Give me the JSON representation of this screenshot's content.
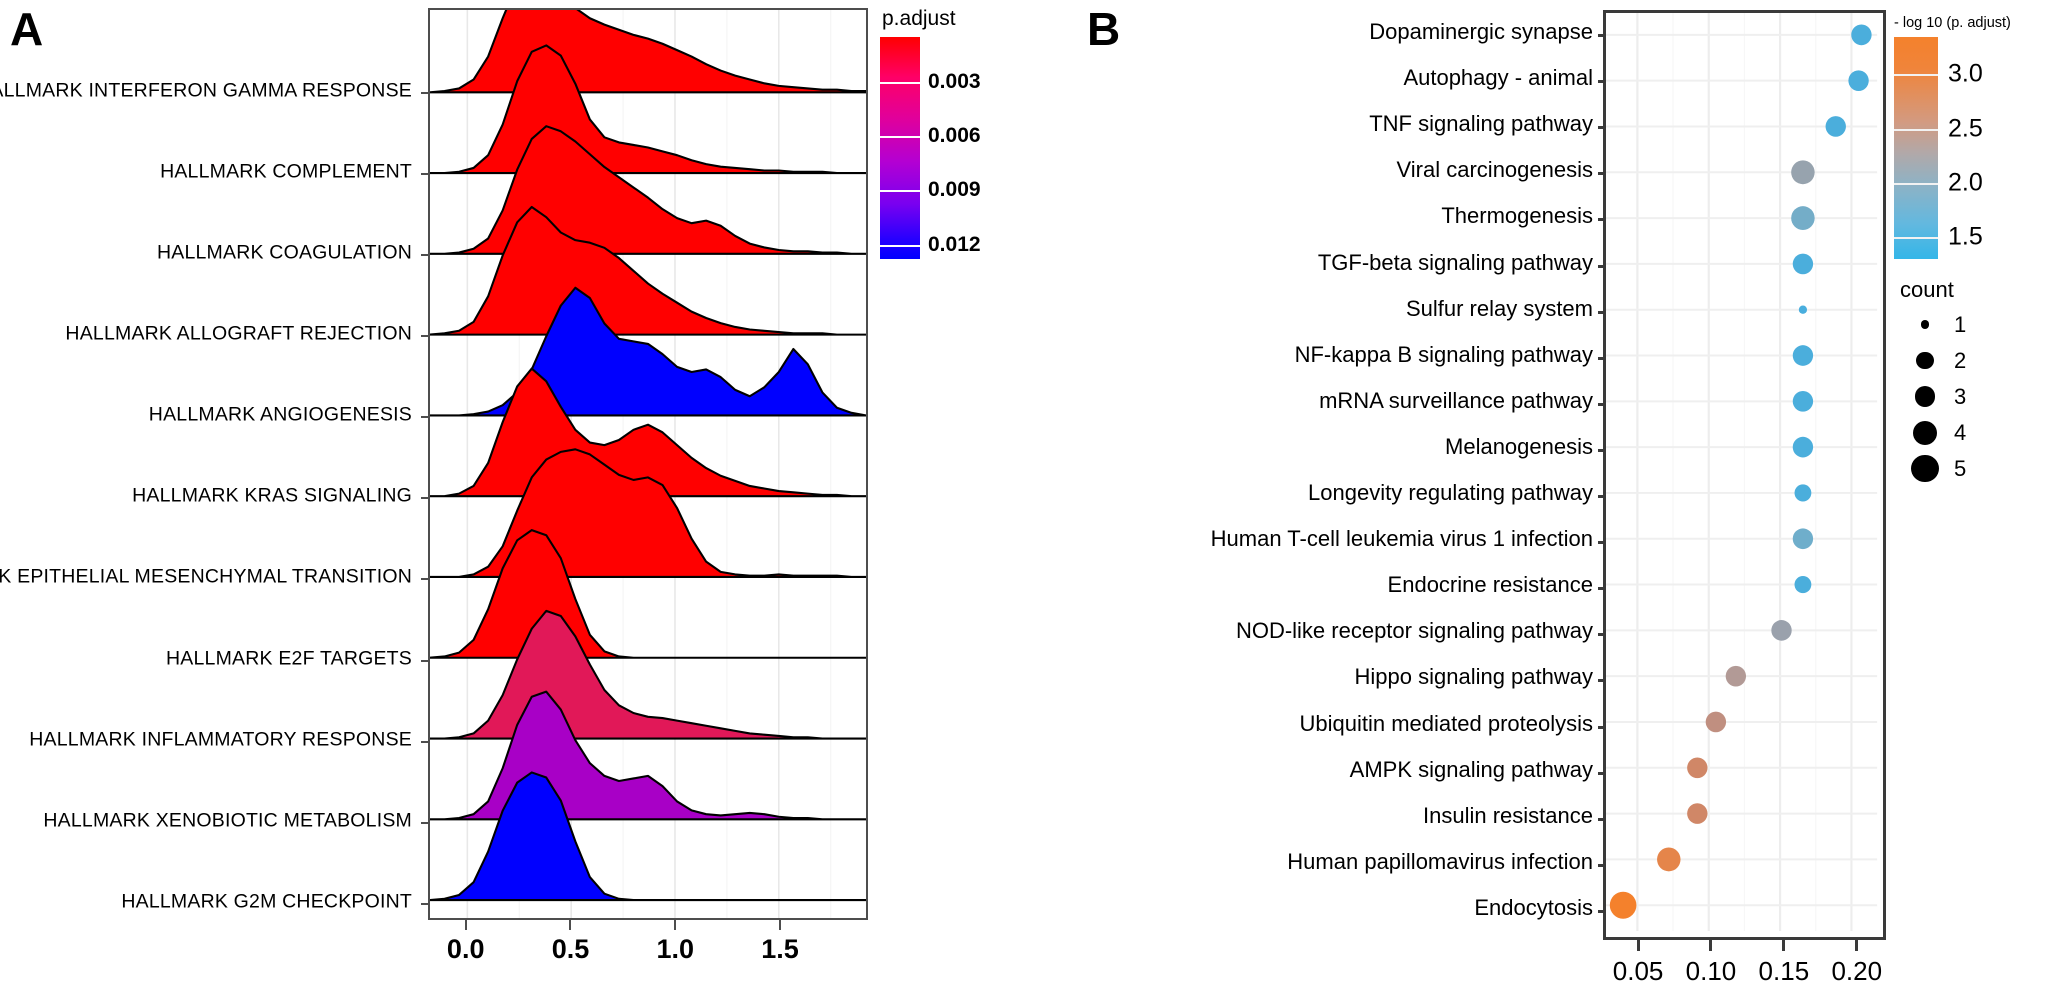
{
  "panels": {
    "a_letter": "A",
    "b_letter": "B"
  },
  "chart_data": [
    {
      "type": "area",
      "id": "ridgeline-gsea",
      "title": "",
      "xlabel": "",
      "ylabel": "",
      "xlim": [
        -0.18,
        1.92
      ],
      "xticks": [
        "0.0",
        "0.5",
        "1.0",
        "1.5"
      ],
      "xtick_values": [
        0.0,
        0.5,
        1.0,
        1.5
      ],
      "grid": true,
      "legend": {
        "title": "p.adjust",
        "ticks": [
          "0.003",
          "0.006",
          "0.009",
          "0.012"
        ],
        "tick_values": [
          0.003,
          0.006,
          0.009,
          0.012
        ],
        "colors": {
          "low": "#FF0000",
          "high": "#0000FF"
        },
        "range": [
          0.0005,
          0.0128
        ]
      },
      "categories": [
        "HALLMARK INTERFERON GAMMA RESPONSE",
        "HALLMARK COMPLEMENT",
        "HALLMARK COAGULATION",
        "HALLMARK ALLOGRAFT REJECTION",
        "HALLMARK ANGIOGENESIS",
        "HALLMARK KRAS SIGNALING",
        "HALLMARK EPITHELIAL MESENCHYMAL TRANSITION",
        "HALLMARK E2F TARGETS",
        "HALLMARK INFLAMMATORY RESPONSE",
        "HALLMARK XENOBIOTIC METABOLISM",
        "HALLMARK G2M CHECKPOINT"
      ],
      "series": [
        {
          "name": "HALLMARK INTERFERON GAMMA RESPONSE",
          "p_adjust": 0.0012,
          "color": "#FF0000",
          "density": [
            0.0,
            0.01,
            0.03,
            0.1,
            0.28,
            0.58,
            0.85,
            1.0,
            0.95,
            0.8,
            0.66,
            0.58,
            0.53,
            0.49,
            0.45,
            0.42,
            0.38,
            0.33,
            0.28,
            0.22,
            0.17,
            0.13,
            0.1,
            0.07,
            0.05,
            0.04,
            0.03,
            0.02,
            0.02,
            0.01,
            0.01
          ]
        },
        {
          "name": "HALLMARK COMPLEMENT",
          "p_adjust": 0.0013,
          "color": "#FF0000",
          "density": [
            0.0,
            0.0,
            0.01,
            0.04,
            0.14,
            0.38,
            0.72,
            0.95,
            1.0,
            0.92,
            0.7,
            0.42,
            0.28,
            0.24,
            0.22,
            0.2,
            0.17,
            0.14,
            0.1,
            0.07,
            0.05,
            0.04,
            0.03,
            0.02,
            0.02,
            0.01,
            0.01,
            0.01,
            0.0,
            0.0,
            0.0
          ]
        },
        {
          "name": "HALLMARK COAGULATION",
          "p_adjust": 0.0015,
          "color": "#FF0000",
          "density": [
            0.0,
            0.0,
            0.01,
            0.04,
            0.12,
            0.34,
            0.66,
            0.9,
            1.0,
            0.96,
            0.88,
            0.78,
            0.68,
            0.6,
            0.52,
            0.44,
            0.35,
            0.28,
            0.24,
            0.26,
            0.22,
            0.14,
            0.08,
            0.05,
            0.03,
            0.02,
            0.02,
            0.01,
            0.01,
            0.0,
            0.0
          ]
        },
        {
          "name": "HALLMARK ALLOGRAFT REJECTION",
          "p_adjust": 0.0016,
          "color": "#FF0000",
          "density": [
            0.0,
            0.01,
            0.03,
            0.1,
            0.3,
            0.62,
            0.88,
            1.0,
            0.92,
            0.8,
            0.74,
            0.72,
            0.68,
            0.6,
            0.5,
            0.4,
            0.32,
            0.25,
            0.18,
            0.13,
            0.09,
            0.06,
            0.04,
            0.03,
            0.02,
            0.01,
            0.01,
            0.01,
            0.0,
            0.0,
            0.0
          ]
        },
        {
          "name": "HALLMARK ANGIOGENESIS",
          "p_adjust": 0.0125,
          "color": "#0000FF",
          "density": [
            0.0,
            0.0,
            0.0,
            0.01,
            0.03,
            0.08,
            0.18,
            0.36,
            0.62,
            0.86,
            1.0,
            0.92,
            0.72,
            0.6,
            0.58,
            0.56,
            0.48,
            0.38,
            0.34,
            0.36,
            0.3,
            0.2,
            0.15,
            0.22,
            0.34,
            0.52,
            0.4,
            0.18,
            0.06,
            0.02,
            0.0
          ]
        },
        {
          "name": "HALLMARK KRAS SIGNALING",
          "p_adjust": 0.0017,
          "color": "#FF0000",
          "density": [
            0.0,
            0.0,
            0.02,
            0.08,
            0.26,
            0.58,
            0.86,
            1.0,
            0.9,
            0.7,
            0.52,
            0.42,
            0.4,
            0.44,
            0.52,
            0.56,
            0.5,
            0.4,
            0.3,
            0.22,
            0.16,
            0.12,
            0.08,
            0.06,
            0.04,
            0.03,
            0.02,
            0.01,
            0.01,
            0.0,
            0.0
          ]
        },
        {
          "name": "HALLMARK EPITHELIAL MESENCHYMAL TRANSITION",
          "p_adjust": 0.0011,
          "color": "#FF0000",
          "density": [
            0.0,
            0.0,
            0.0,
            0.02,
            0.08,
            0.24,
            0.52,
            0.78,
            0.92,
            0.98,
            1.0,
            0.96,
            0.88,
            0.8,
            0.76,
            0.78,
            0.72,
            0.54,
            0.3,
            0.12,
            0.04,
            0.02,
            0.01,
            0.01,
            0.02,
            0.01,
            0.01,
            0.01,
            0.01,
            0.0,
            0.0
          ]
        },
        {
          "name": "HALLMARK E2F TARGETS",
          "p_adjust": 0.001,
          "color": "#FF0000",
          "density": [
            0.0,
            0.01,
            0.04,
            0.14,
            0.38,
            0.7,
            0.92,
            1.0,
            0.96,
            0.78,
            0.46,
            0.18,
            0.05,
            0.01,
            0.0,
            0.0,
            0.0,
            0.0,
            0.0,
            0.0,
            0.0,
            0.0,
            0.0,
            0.0,
            0.0,
            0.0,
            0.0,
            0.0,
            0.0,
            0.0,
            0.0
          ]
        },
        {
          "name": "HALLMARK INFLAMMATORY RESPONSE",
          "p_adjust": 0.0042,
          "color": "#E11858",
          "density": [
            0.0,
            0.0,
            0.01,
            0.04,
            0.14,
            0.34,
            0.62,
            0.86,
            1.0,
            0.96,
            0.8,
            0.58,
            0.38,
            0.26,
            0.2,
            0.17,
            0.16,
            0.14,
            0.12,
            0.1,
            0.08,
            0.06,
            0.04,
            0.03,
            0.02,
            0.01,
            0.01,
            0.0,
            0.0,
            0.0,
            0.0
          ]
        },
        {
          "name": "HALLMARK XENOBIOTIC METABOLISM",
          "p_adjust": 0.008,
          "color": "#A800C6",
          "density": [
            0.0,
            0.0,
            0.01,
            0.04,
            0.14,
            0.4,
            0.74,
            0.96,
            1.0,
            0.86,
            0.62,
            0.44,
            0.34,
            0.3,
            0.32,
            0.34,
            0.26,
            0.14,
            0.07,
            0.04,
            0.03,
            0.04,
            0.05,
            0.04,
            0.02,
            0.01,
            0.01,
            0.0,
            0.0,
            0.0,
            0.0
          ]
        },
        {
          "name": "HALLMARK G2M CHECKPOINT",
          "p_adjust": 0.0128,
          "color": "#0000FF",
          "density": [
            0.0,
            0.01,
            0.04,
            0.14,
            0.38,
            0.7,
            0.92,
            1.0,
            0.96,
            0.78,
            0.46,
            0.18,
            0.05,
            0.01,
            0.0,
            0.0,
            0.0,
            0.0,
            0.0,
            0.0,
            0.0,
            0.0,
            0.0,
            0.0,
            0.0,
            0.0,
            0.0,
            0.0,
            0.0,
            0.0,
            0.0
          ]
        }
      ]
    },
    {
      "type": "scatter",
      "id": "kegg-dotplot",
      "title": "",
      "xlabel": "",
      "ylabel": "",
      "xlim": [
        0.028,
        0.218
      ],
      "xticks": [
        "0.05",
        "0.10",
        "0.15",
        "0.20"
      ],
      "xtick_values": [
        0.05,
        0.1,
        0.15,
        0.2
      ],
      "grid": true,
      "legends": [
        {
          "title": "- log 10 (p. adjust)",
          "ticks": [
            "3.0",
            "2.5",
            "2.0",
            "1.5"
          ],
          "tick_values": [
            3.0,
            2.5,
            2.0,
            1.5
          ],
          "colors": {
            "high": "#F4812C",
            "low": "#34B6E8"
          },
          "range": [
            1.3,
            3.35
          ]
        },
        {
          "title": "count",
          "ticks": [
            "1",
            "2",
            "3",
            "4",
            "5"
          ],
          "tick_values": [
            1,
            2,
            3,
            4,
            5
          ]
        }
      ],
      "points": [
        {
          "label": "Dopaminergic synapse",
          "x": 0.207,
          "count": 3,
          "logp": 1.62,
          "color": "#4BAEDC"
        },
        {
          "label": "Autophagy - animal",
          "x": 0.205,
          "count": 3,
          "logp": 1.6,
          "color": "#4BAEDC"
        },
        {
          "label": "TNF signaling pathway",
          "x": 0.189,
          "count": 3,
          "logp": 1.58,
          "color": "#4BAEDC"
        },
        {
          "label": "Viral carcinogenesis",
          "x": 0.166,
          "count": 4,
          "logp": 1.86,
          "color": "#97A3AE"
        },
        {
          "label": "Thermogenesis",
          "x": 0.166,
          "count": 4,
          "logp": 1.7,
          "color": "#74ADC8"
        },
        {
          "label": "TGF-beta signaling pathway",
          "x": 0.166,
          "count": 3,
          "logp": 1.58,
          "color": "#4BAEDC"
        },
        {
          "label": "Sulfur relay system",
          "x": 0.166,
          "count": 1,
          "logp": 1.52,
          "color": "#49AEDE"
        },
        {
          "label": "NF-kappa B signaling pathway",
          "x": 0.166,
          "count": 3,
          "logp": 1.55,
          "color": "#4BAEDC"
        },
        {
          "label": "mRNA surveillance pathway",
          "x": 0.166,
          "count": 3,
          "logp": 1.55,
          "color": "#4BAEDC"
        },
        {
          "label": "Melanogenesis",
          "x": 0.166,
          "count": 3,
          "logp": 1.55,
          "color": "#4BAEDC"
        },
        {
          "label": "Longevity regulating pathway",
          "x": 0.166,
          "count": 2,
          "logp": 1.52,
          "color": "#4BAEDC"
        },
        {
          "label": "Human T-cell leukemia virus 1 infection",
          "x": 0.166,
          "count": 3,
          "logp": 1.72,
          "color": "#6FAECB"
        },
        {
          "label": "Endocrine resistance",
          "x": 0.166,
          "count": 2,
          "logp": 1.5,
          "color": "#4BAEDC"
        },
        {
          "label": "NOD-like receptor signaling pathway",
          "x": 0.151,
          "count": 3,
          "logp": 1.9,
          "color": "#9AA1AC"
        },
        {
          "label": "Hippo signaling pathway",
          "x": 0.119,
          "count": 3,
          "logp": 2.12,
          "color": "#B29A96"
        },
        {
          "label": "Ubiquitin mediated proteolysis",
          "x": 0.105,
          "count": 3,
          "logp": 2.28,
          "color": "#C08F80"
        },
        {
          "label": "AMPK signaling pathway",
          "x": 0.092,
          "count": 3,
          "logp": 2.5,
          "color": "#D08767"
        },
        {
          "label": "Insulin resistance",
          "x": 0.092,
          "count": 3,
          "logp": 2.52,
          "color": "#D08767"
        },
        {
          "label": "Human papillomavirus infection",
          "x": 0.072,
          "count": 4,
          "logp": 2.9,
          "color": "#E5854A"
        },
        {
          "label": "Endocytosis",
          "x": 0.04,
          "count": 5,
          "logp": 3.35,
          "color": "#F4812C"
        }
      ]
    }
  ]
}
